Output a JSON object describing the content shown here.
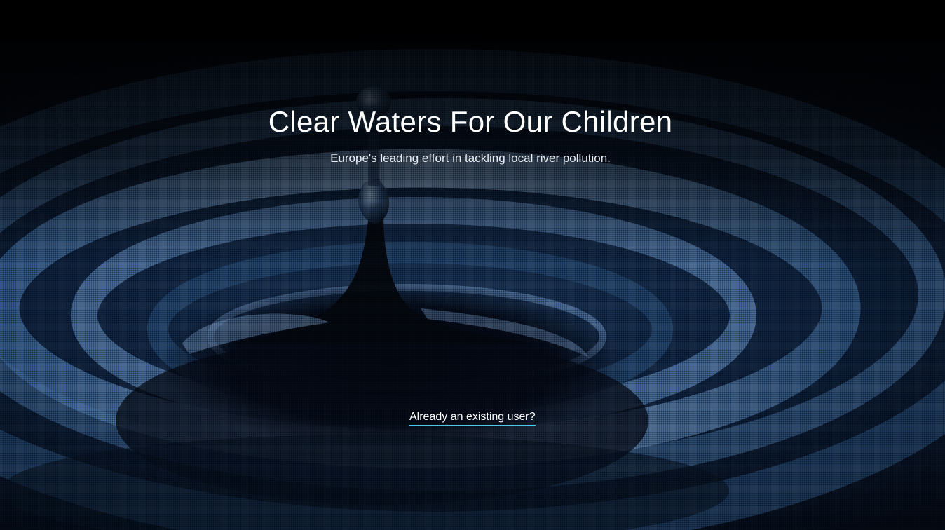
{
  "hero": {
    "title": "Clear Waters For Our Children",
    "subtitle": "Europe's leading effort in tackling local river pollution.",
    "login_link": "Already an existing user?",
    "background_image": "water-droplet-ripple-image"
  },
  "colors": {
    "text": "#ffffff",
    "link_underline": "#4ec8e8",
    "water_highlight": "#6d96c8",
    "water_dark": "#02050b"
  }
}
